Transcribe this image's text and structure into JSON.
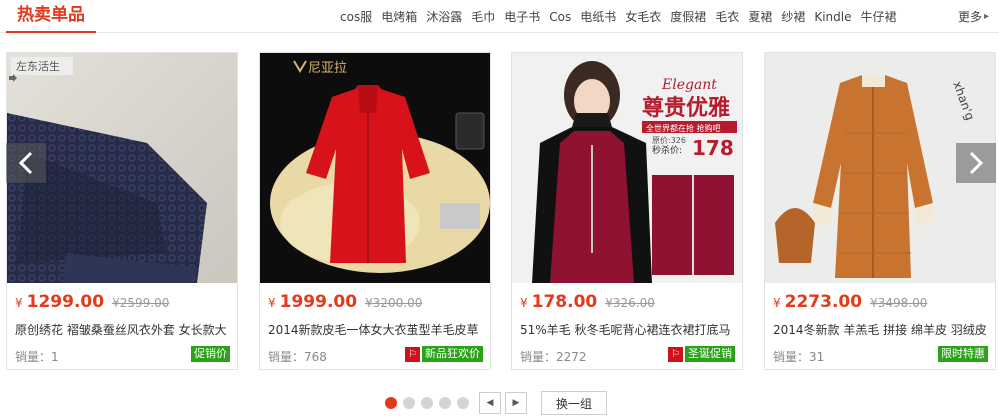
{
  "header": {
    "title": "热卖单品",
    "tags": [
      "cos服",
      "电烤箱",
      "沐浴露",
      "毛巾",
      "电子书",
      "Cos",
      "电纸书",
      "女毛衣",
      "度假裙",
      "毛衣",
      "夏裙",
      "纱裙",
      "Kindle",
      "牛仔裙"
    ],
    "more_label": "更多"
  },
  "products": [
    {
      "image_icon": "navy-lace-cardigan-image",
      "watermark": "左东活生",
      "currency": "¥",
      "price": "1299.00",
      "original_price": "¥2599.00",
      "name": "原创绣花 褶皱桑蚕丝风衣外套 女长款大",
      "sales": "销量：1",
      "promo_label": "促销价"
    },
    {
      "image_icon": "red-wool-coat-image",
      "brand": "尼亚拉",
      "currency": "¥",
      "price": "1999.00",
      "original_price": "¥3200.00",
      "name": "2014新款皮毛一体女大衣茧型羊毛皮草",
      "sales": "销量：768",
      "promo_label": "新品狂欢价"
    },
    {
      "image_icon": "wine-red-dress-image",
      "banner_script": "Elegant",
      "banner_title": "尊贵优雅",
      "banner_sub": "全世界都在抢 抢购吧",
      "banner_orig": "原价:326",
      "banner_price_label": "秒杀价:",
      "banner_price": "178",
      "currency": "¥",
      "price": "178.00",
      "original_price": "¥326.00",
      "name": "51%羊毛 秋冬毛呢背心裙连衣裙打底马",
      "sales": "销量：2272",
      "promo_label": "圣诞促销"
    },
    {
      "image_icon": "orange-down-jacket-image",
      "watermark": "xhan'g",
      "currency": "¥",
      "price": "2273.00",
      "original_price": "¥3498.00",
      "name": "2014冬新款 羊羔毛 拼接 绵羊皮 羽绒皮",
      "sales": "销量：31",
      "promo_label": "限时特惠"
    }
  ],
  "carousel": {
    "pages": 5,
    "active_page": 1,
    "swap_label": "换一组"
  },
  "colors": {
    "accent": "#e4391b",
    "promo_green": "#2aa318",
    "promo_red": "#d0101b"
  }
}
